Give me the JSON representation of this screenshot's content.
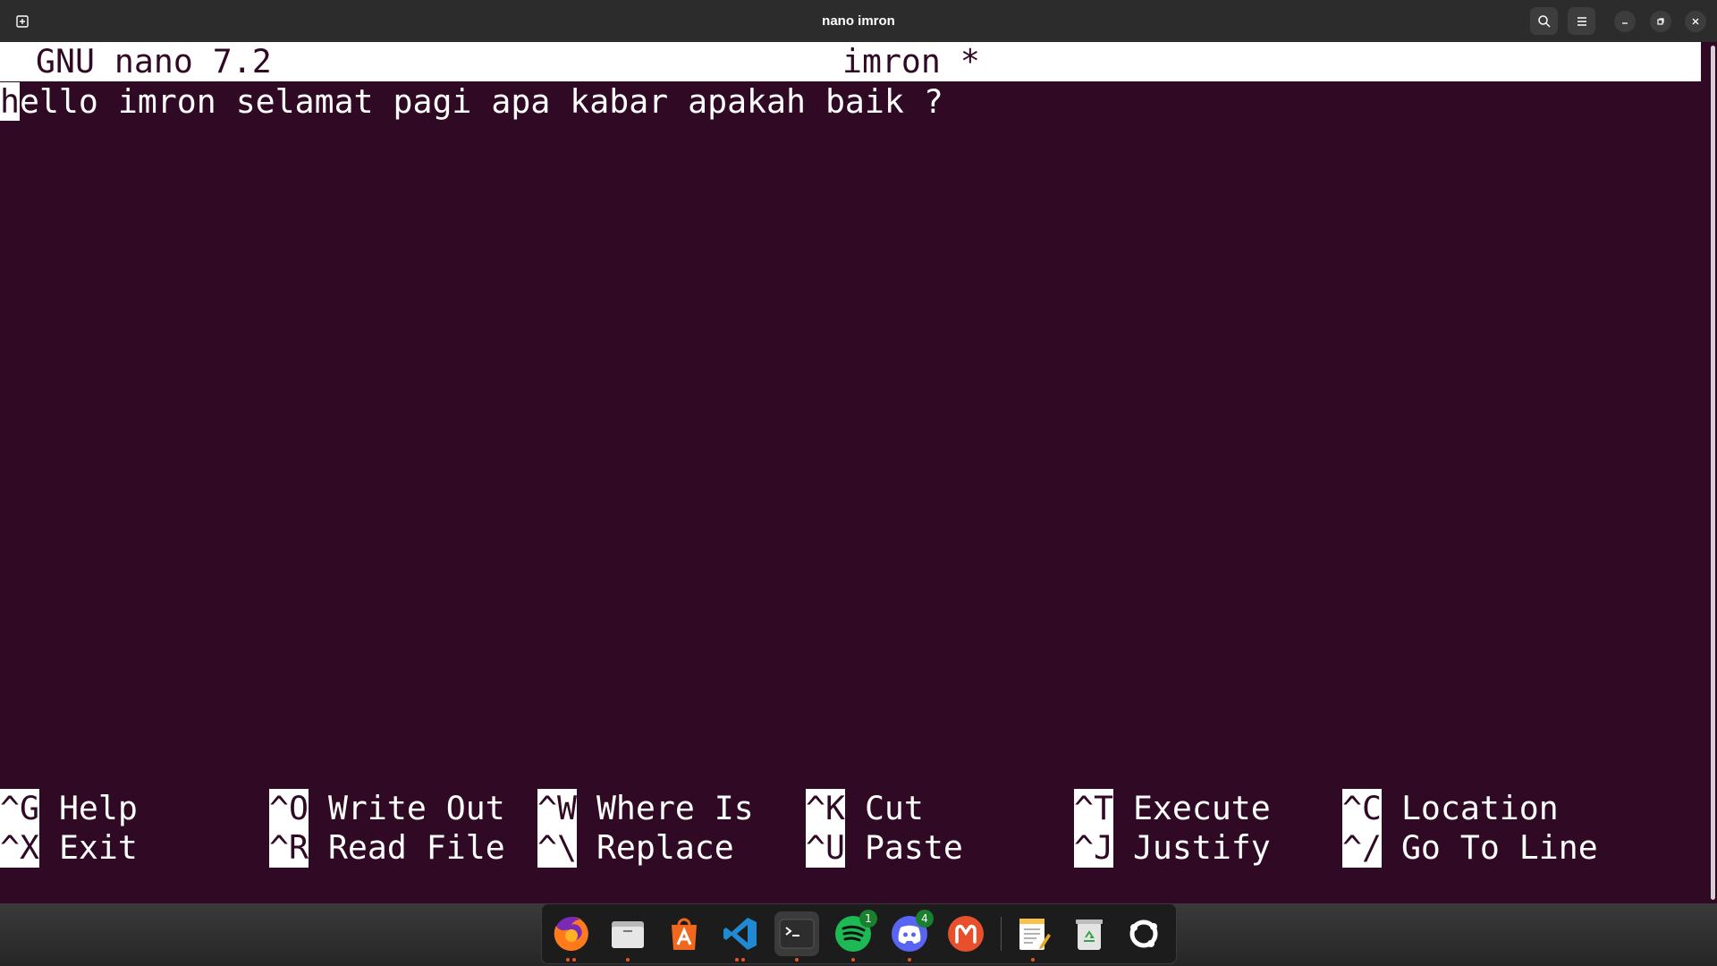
{
  "window": {
    "title": "nano imron"
  },
  "nano": {
    "version": "GNU nano 7.2",
    "filename": "imron *",
    "cursor_char": "h",
    "line_rest": "ello imron selamat pagi apa kabar apakah baik ?"
  },
  "shortcuts": {
    "row1": [
      {
        "key": "^G",
        "label": "Help"
      },
      {
        "key": "^O",
        "label": "Write Out"
      },
      {
        "key": "^W",
        "label": "Where Is"
      },
      {
        "key": "^K",
        "label": "Cut"
      },
      {
        "key": "^T",
        "label": "Execute"
      },
      {
        "key": "^C",
        "label": "Location"
      }
    ],
    "row2": [
      {
        "key": "^X",
        "label": "Exit"
      },
      {
        "key": "^R",
        "label": "Read File"
      },
      {
        "key": "^\\",
        "label": "Replace"
      },
      {
        "key": "^U",
        "label": "Paste"
      },
      {
        "key": "^J",
        "label": "Justify"
      },
      {
        "key": "^/",
        "label": "Go To Line"
      }
    ]
  },
  "dock": {
    "apps": [
      {
        "name": "firefox-icon"
      },
      {
        "name": "files-icon"
      },
      {
        "name": "app-center-icon"
      },
      {
        "name": "vscode-icon"
      },
      {
        "name": "terminal-icon"
      },
      {
        "name": "spotify-icon",
        "badge": "1"
      },
      {
        "name": "discord-icon",
        "badge": "4"
      },
      {
        "name": "mendeley-icon"
      },
      {
        "name": "text-editor-icon"
      },
      {
        "name": "trash-icon"
      },
      {
        "name": "show-apps-icon"
      }
    ]
  },
  "colors": {
    "terminal_bg": "#300a24",
    "titlebar_bg": "#2c2c2c",
    "accent": "#e95420"
  }
}
